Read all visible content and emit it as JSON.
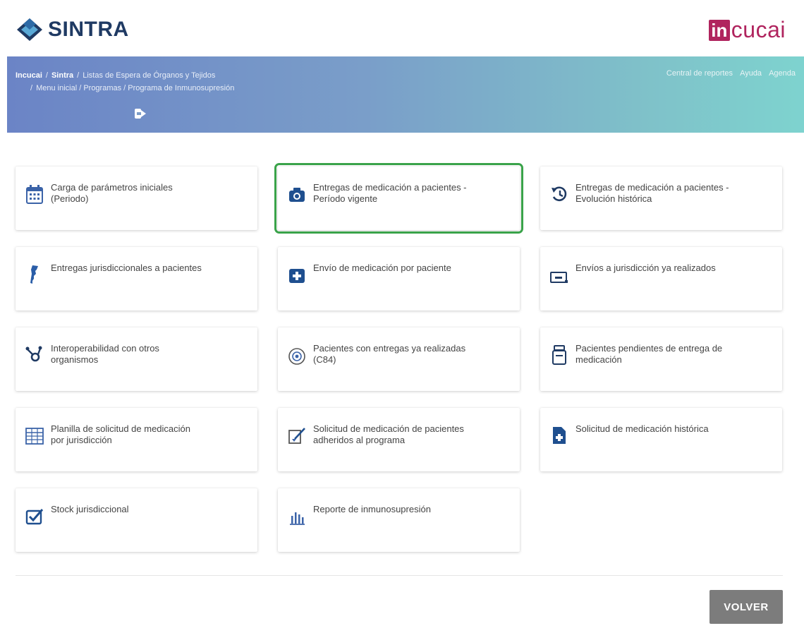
{
  "header": {
    "brand_left": "SINTRA",
    "brand_right_box": "in",
    "brand_right_rest": "cucai",
    "colors": {
      "sintra_blue": "#1f3a63",
      "incucai_magenta": "#b0245e",
      "selected_border": "#3aa34a"
    }
  },
  "breadcrumb": {
    "item1": "Incucai",
    "item2": "Sintra",
    "item3": "Listas de Espera de Órganos y Tejidos",
    "line2": "Menu inicial / Programas / Programa de Inmunosupresión"
  },
  "top_links": {
    "reports": "Central de reportes",
    "help": "Ayuda",
    "agenda": "Agenda"
  },
  "icons": {
    "logout": "logout-icon"
  },
  "cards": [
    {
      "label": "Carga de parámetros iniciales\n(Periodo)",
      "icon": "calendar-icon"
    },
    {
      "label": "Entregas de medicación a pacientes -\nPeríodo vigente",
      "icon": "camera-icon"
    },
    {
      "label": "Entregas de medicación a pacientes -\nEvolución histórica",
      "icon": "history-icon"
    },
    {
      "label": "Entregas jurisdiccionales a pacientes",
      "icon": "argentina-map-icon"
    },
    {
      "label": "Envío de medicación por paciente",
      "icon": "medical-box-icon"
    },
    {
      "label": "Envíos a jurisdicción ya realizados",
      "icon": "transfer-icon"
    },
    {
      "label": "Interoperabilidad con otros\norganismos",
      "icon": "hub-icon"
    },
    {
      "label": "Pacientes con entregas ya realizadas\n(C84)",
      "icon": "target-icon"
    },
    {
      "label": "Pacientes pendientes de entrega de\nmedicación",
      "icon": "pill-bottle-icon"
    },
    {
      "label": "Planilla de solicitud de medicación\npor jurisdicción",
      "icon": "spreadsheet-icon"
    },
    {
      "label": "Solicitud de medicación de pacientes\nadheridos al programa",
      "icon": "edit-form-icon"
    },
    {
      "label": "Solicitud de medicación histórica",
      "icon": "medical-document-icon"
    },
    {
      "label": "Stock jurisdiccional",
      "icon": "checkbox-icon"
    },
    {
      "label": "Reporte de inmunosupresión",
      "icon": "bar-chart-icon"
    }
  ],
  "footer": {
    "back_button": "VOLVER"
  }
}
